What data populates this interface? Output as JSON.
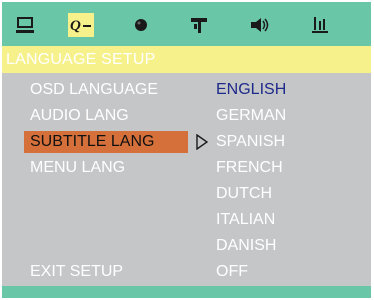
{
  "header": {
    "title": "LANGUAGE SETUP",
    "icons": [
      "monitor-icon",
      "language-icon",
      "sphere-icon",
      "tool-icon",
      "speaker-icon",
      "signal-icon"
    ],
    "selected_icon": "language-icon"
  },
  "menu": {
    "items": [
      {
        "label": "OSD LANGUAGE"
      },
      {
        "label": "AUDIO LANG"
      },
      {
        "label": "SUBTITLE LANG"
      },
      {
        "label": "MENU LANG"
      }
    ],
    "selected_index": 2,
    "exit_label": "EXIT SETUP"
  },
  "options": {
    "current": "ENGLISH",
    "items": [
      "GERMAN",
      "SPANISH",
      "FRENCH",
      "DUTCH",
      "ITALIAN",
      "DANISH",
      "OFF"
    ]
  },
  "colors": {
    "icon_bar": "#69c7a8",
    "title_bar": "#f6f18a",
    "panel": "#c5c6c8",
    "highlight": "#d6703a",
    "current_option": "#1d2a8a"
  }
}
